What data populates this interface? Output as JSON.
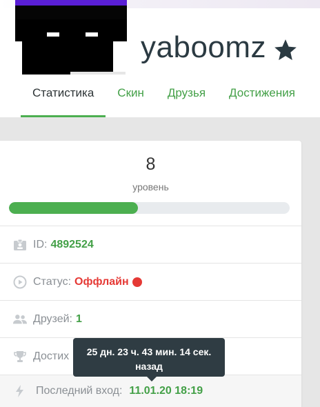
{
  "profile": {
    "username": "yaboomz",
    "favorite_icon": "star-icon"
  },
  "tabs": [
    {
      "label": "Статистика",
      "active": true
    },
    {
      "label": "Скин",
      "active": false
    },
    {
      "label": "Друзья",
      "active": false
    },
    {
      "label": "Достижения",
      "active": false
    }
  ],
  "level": {
    "value": "8",
    "label": "уровень",
    "progress_fraction": 0.46
  },
  "stats": {
    "id_label": "ID:",
    "id_value": "4892524",
    "status_label": "Статус:",
    "status_value": "Оффлайн",
    "friends_label": "Друзей:",
    "friends_value": "1",
    "achievements_label_visible": "Достих",
    "last_login_label": "Последний вход:",
    "last_login_value": "11.01.20 18:19"
  },
  "tooltip": {
    "line1": "25 дн. 23 ч. 43 мин. 14 сек.",
    "line2": "назад"
  },
  "colors": {
    "accent_green": "#43a047",
    "offline_red": "#e53935",
    "tooltip_bg": "#2f3c43"
  }
}
